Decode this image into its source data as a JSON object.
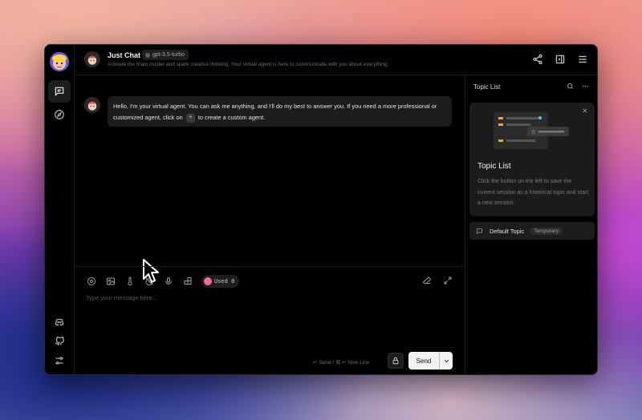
{
  "header": {
    "title": "Just Chat",
    "model": "gpt-3.5-turbo",
    "subtitle": "Activate the brain cluster and spark creative thinking. Your virtual agent is here to communicate with you about everything."
  },
  "chat": {
    "message_part1": "Hello, I'm your virtual agent. You can ask me anything, and I'll do my best to answer you. If you need a more professional or customized agent, click on",
    "plus_symbol": "+",
    "message_part2": "to create a custom agent."
  },
  "input": {
    "placeholder": "Type your message here...",
    "used_label": "Used 0",
    "send_hint": "↵ Send / ⌘ ↵ New Line",
    "send_label": "Send"
  },
  "topics": {
    "title": "Topic List",
    "tip_title": "Topic List",
    "tip_description": "Click the button on the left to save the current session as a historical topic and start a new session.",
    "items": [
      {
        "label": "Default Topic",
        "tag": "Temporary"
      }
    ]
  },
  "icons": {
    "rail": [
      "chat-icon",
      "compass-icon",
      "discord-icon",
      "github-icon",
      "settings-icon"
    ],
    "header_actions": [
      "share-icon",
      "panel-icon",
      "menu-icon"
    ],
    "input_tools": [
      "settings-circle-icon",
      "image-icon",
      "temperature-icon",
      "history-off-icon",
      "mic-icon",
      "plugins-icon"
    ],
    "input_right": [
      "eraser-icon",
      "expand-icon"
    ]
  }
}
